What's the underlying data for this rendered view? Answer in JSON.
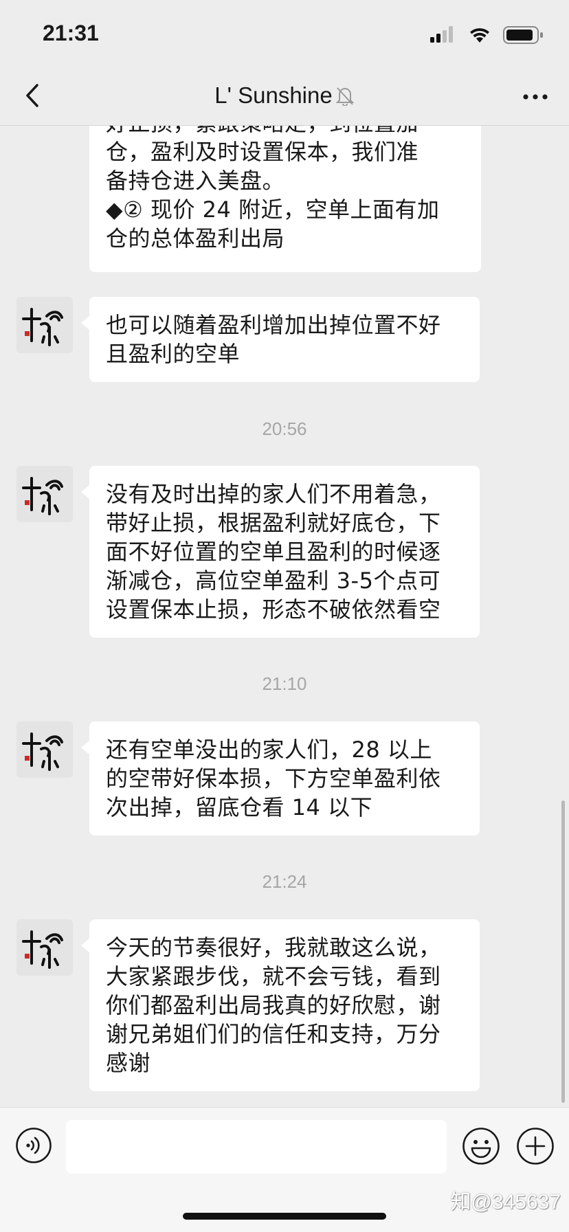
{
  "status_bar": {
    "time": "21:31"
  },
  "header": {
    "title": "L' Sunshine"
  },
  "messages": [
    {
      "lines": [
        "好止损，紧跟策略走，到位置加",
        "仓，盈利及时设置保本，我们准",
        "备持仓进入美盘。",
        "◆② 现价 24 附近，空单上面有加",
        "仓的总体盈利出局"
      ]
    },
    {
      "lines": [
        "也可以随着盈利增加出掉位置不好",
        "且盈利的空单"
      ]
    },
    {
      "lines": [
        "没有及时出掉的家人们不用着急，",
        "带好止损，根据盈利就好底仓，下",
        "面不好位置的空单且盈利的时候逐",
        "渐减仓，高位空单盈利 3-5个点可",
        "设置保本止损，形态不破依然看空"
      ]
    },
    {
      "lines": [
        "还有空单没出的家人们，28 以上",
        "的空带好保本损，下方空单盈利依",
        "次出掉，留底仓看 14 以下"
      ]
    },
    {
      "lines": [
        "今天的节奏很好，我就敢这么说，",
        "大家紧跟步伐，就不会亏钱，看到",
        "你们都盈利出局我真的好欣慰，谢",
        "谢兄弟姐们们的信任和支持，万分",
        "感谢"
      ]
    }
  ],
  "timestamps": [
    "20:56",
    "21:10",
    "21:24"
  ],
  "input": {
    "value": ""
  },
  "watermark": "知@345637",
  "icons": {
    "back": "chevron-left-icon",
    "mute": "bell-slash-icon",
    "more": "more-dots-icon",
    "voice": "voice-icon",
    "emoji": "emoji-icon",
    "plus": "plus-icon"
  }
}
